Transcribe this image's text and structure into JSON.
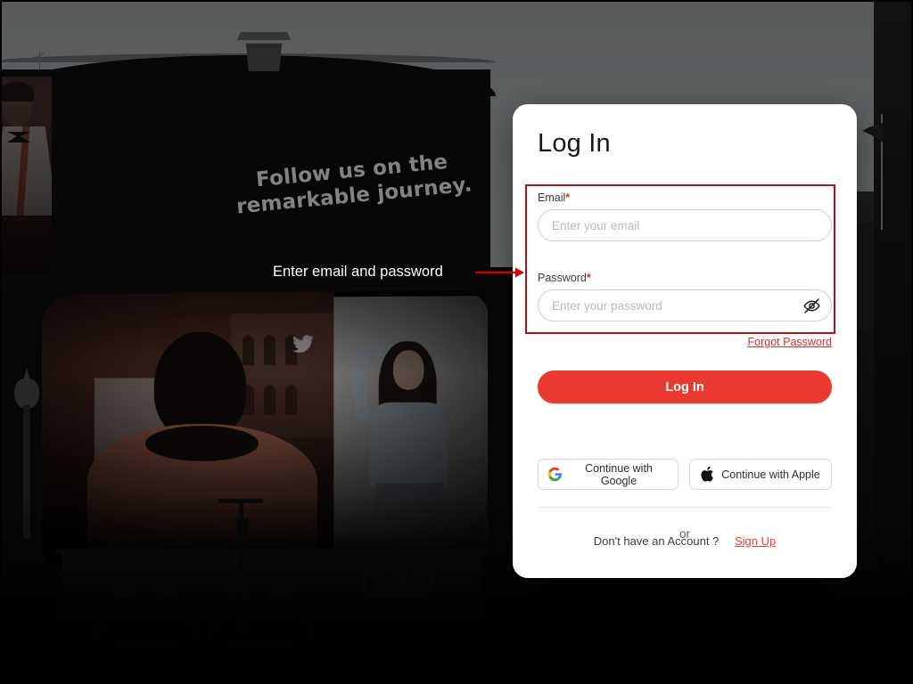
{
  "background": {
    "billboard_text": "Follow us on the remarkable journey.",
    "store_sign": "GAP",
    "twitter_glyph": "🐦"
  },
  "annotation": {
    "text": "Enter email and password",
    "arrow_color": "#cc0000",
    "text_color": "#ffffff",
    "highlight_color": "#b21218"
  },
  "card": {
    "title": "Log In",
    "email": {
      "label": "Email",
      "required_mark": "*",
      "placeholder": "Enter your email",
      "value": ""
    },
    "password": {
      "label": "Password",
      "required_mark": "*",
      "placeholder": "Enter your password",
      "value": "",
      "toggle_icon": "eye-off-icon"
    },
    "forgot_password_label": "Forgot Password",
    "login_button_label": "Log In",
    "login_button_color": "#ea3a30",
    "or_label": "or",
    "social_buttons": [
      {
        "label": "Continue with Google",
        "icon": "google-icon"
      },
      {
        "label": "Continue with Apple",
        "icon": "apple-icon"
      }
    ],
    "signup_prompt": "Don't have an Account ?",
    "signup_link_label": "Sign Up",
    "signup_link_color": "#e8403a"
  }
}
